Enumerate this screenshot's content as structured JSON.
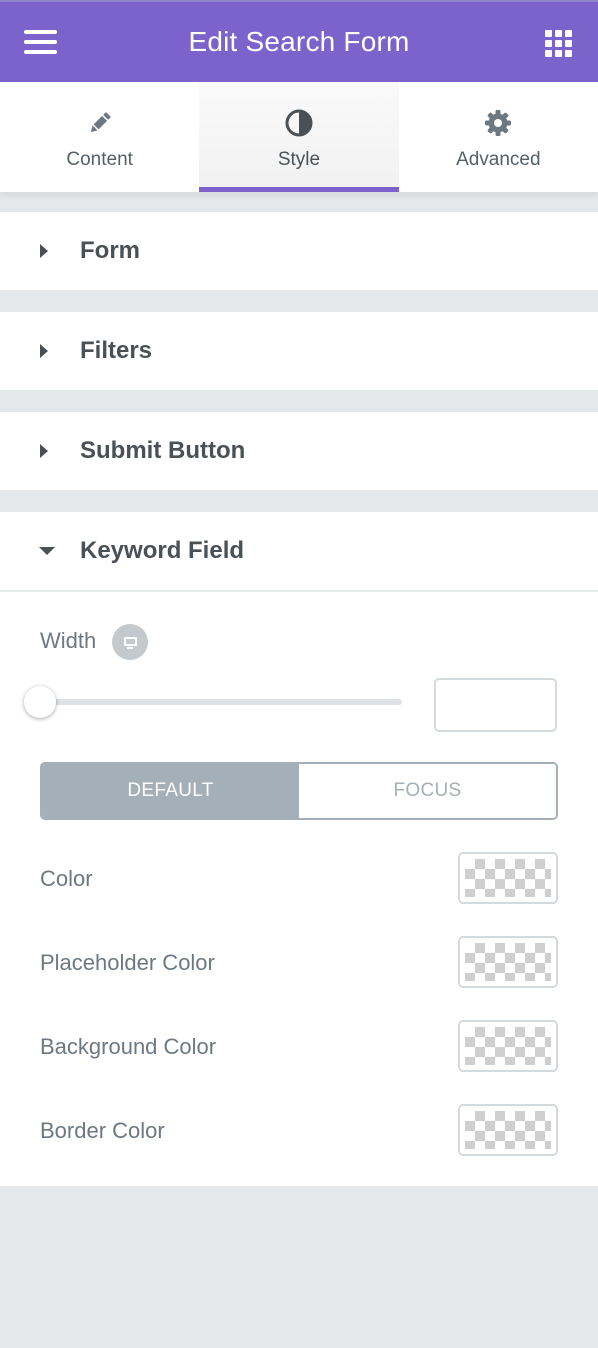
{
  "header": {
    "title": "Edit Search Form",
    "menu_icon": "hamburger-icon",
    "apps_icon": "grid-icon",
    "accent": "#7c63cc"
  },
  "tabs": [
    {
      "label": "Content",
      "icon": "pencil-icon",
      "active": false
    },
    {
      "label": "Style",
      "icon": "half-circle-icon",
      "active": true
    },
    {
      "label": "Advanced",
      "icon": "gear-icon",
      "active": false
    }
  ],
  "sections": [
    {
      "title": "Form",
      "expanded": false
    },
    {
      "title": "Filters",
      "expanded": false
    },
    {
      "title": "Submit Button",
      "expanded": false
    },
    {
      "title": "Keyword Field",
      "expanded": true
    }
  ],
  "keyword_field": {
    "width": {
      "label": "Width",
      "device_icon": "desktop-icon",
      "value": "",
      "slider_value": 0
    },
    "state_switcher": {
      "options": [
        "DEFAULT",
        "FOCUS"
      ],
      "selected": "DEFAULT"
    },
    "colors": [
      {
        "label": "Color"
      },
      {
        "label": "Placeholder Color"
      },
      {
        "label": "Background Color"
      },
      {
        "label": "Border Color"
      }
    ]
  }
}
